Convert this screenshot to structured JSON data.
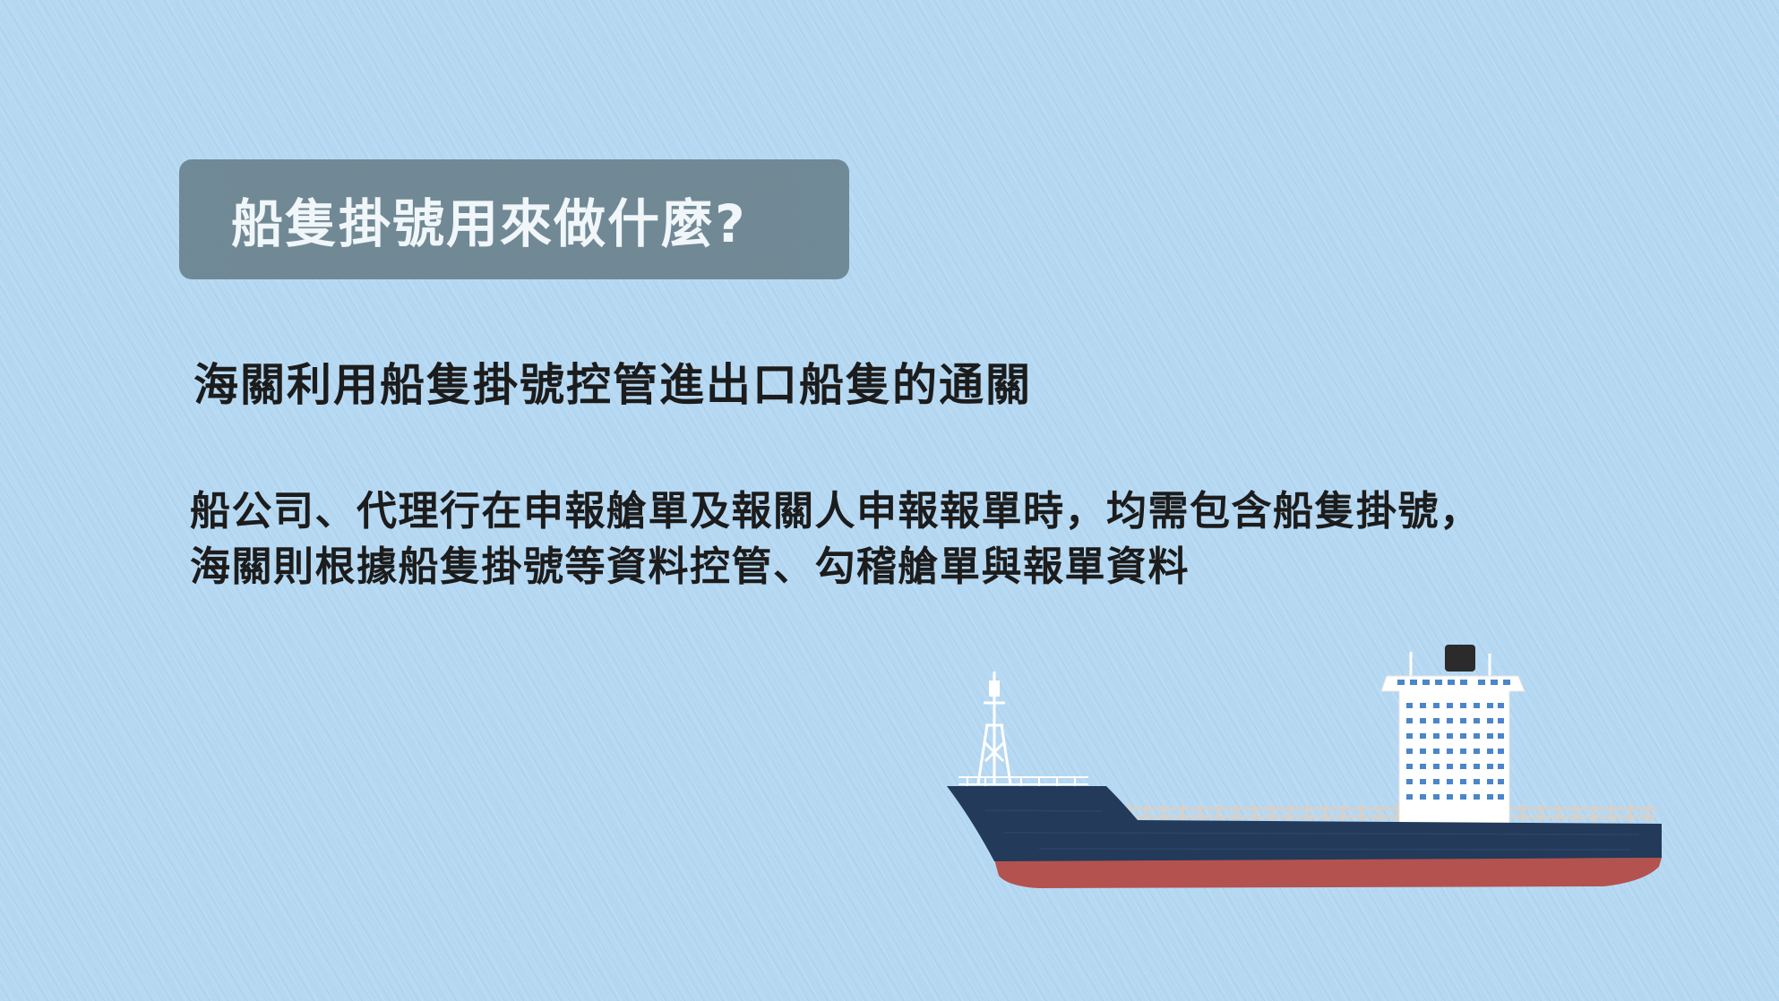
{
  "slide": {
    "title": "船隻掛號用來做什麼?",
    "subtitle": "海關利用船隻掛號控管進出口船隻的通關",
    "body_lines": [
      "船公司、代理行在申報艙單及報關人申報報單時，均需包含船隻掛號，",
      "海關則根據船隻掛號等資料控管、勾稽艙單與報單資料"
    ]
  },
  "colors": {
    "background": "#b5d8f2",
    "title_box": "#6d8591",
    "hull_upper": "#233a5a",
    "hull_lower": "#b4524f",
    "superstructure": "#ffffff",
    "windows": "#4a86c8"
  },
  "illustration": {
    "icon": "cargo-ship-icon"
  }
}
